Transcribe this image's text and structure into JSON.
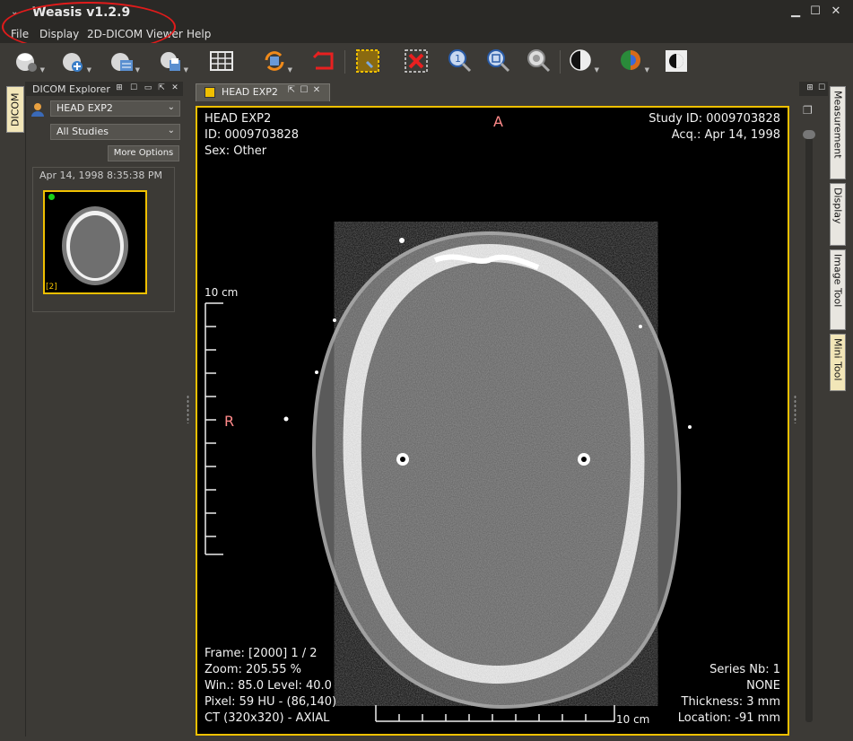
{
  "app": {
    "title": "Weasis v1.2.9"
  },
  "menu": [
    "File",
    "Display",
    "2D-DICOM Viewer",
    "Help"
  ],
  "toolbar": {
    "tools": [
      {
        "name": "open-dicom-icon"
      },
      {
        "name": "import-dicom-icon"
      },
      {
        "name": "export-dicom-icon"
      },
      {
        "name": "print-icon"
      },
      {
        "name": "layout-grid-icon"
      },
      {
        "name": "synch-icon"
      },
      {
        "name": "reset-icon"
      },
      {
        "name": "select-zoom-icon"
      },
      {
        "name": "delete-icon"
      },
      {
        "name": "zoom-1-icon"
      },
      {
        "name": "best-fit-icon"
      },
      {
        "name": "lens-icon"
      },
      {
        "name": "window-level-icon"
      },
      {
        "name": "lut-icon"
      },
      {
        "name": "invert-icon"
      }
    ]
  },
  "left_tab": {
    "label": "DICOM"
  },
  "explorer": {
    "title": "DICOM Explorer",
    "patient": "HEAD EXP2",
    "studies": "All Studies",
    "more_options": "More Options",
    "series_date": "Apr 14, 1998 8:35:38 PM",
    "thumbnail_label": "[2]"
  },
  "viewer": {
    "tab_label": "HEAD EXP2",
    "overlay": {
      "top_left": [
        "HEAD EXP2",
        "ID: 0009703828",
        "Sex: Other"
      ],
      "top_right": [
        "Study ID: 0009703828",
        "Acq.: Apr 14, 1998"
      ],
      "bottom_left": [
        "Frame: [2000] 1 / 2",
        "Zoom: 205.55 %",
        "Win.: 85.0 Level: 40.0",
        "Pixel: 59 HU - (86,140)",
        "CT (320x320) - AXIAL"
      ],
      "bottom_right": [
        "Series Nb: 1",
        "NONE",
        "Thickness: 3 mm",
        "Location: -91 mm"
      ],
      "orient_top": "A",
      "orient_left": "R",
      "scale_vertical": "10 cm",
      "scale_horizontal": "10 cm"
    }
  },
  "right_tabs": [
    "Measurement",
    "Display",
    "Image Tool",
    "Mini Tool"
  ],
  "colors": {
    "accent": "#f0c000",
    "annotation": "#e01b1b",
    "orientation": "#ff8a8a"
  }
}
